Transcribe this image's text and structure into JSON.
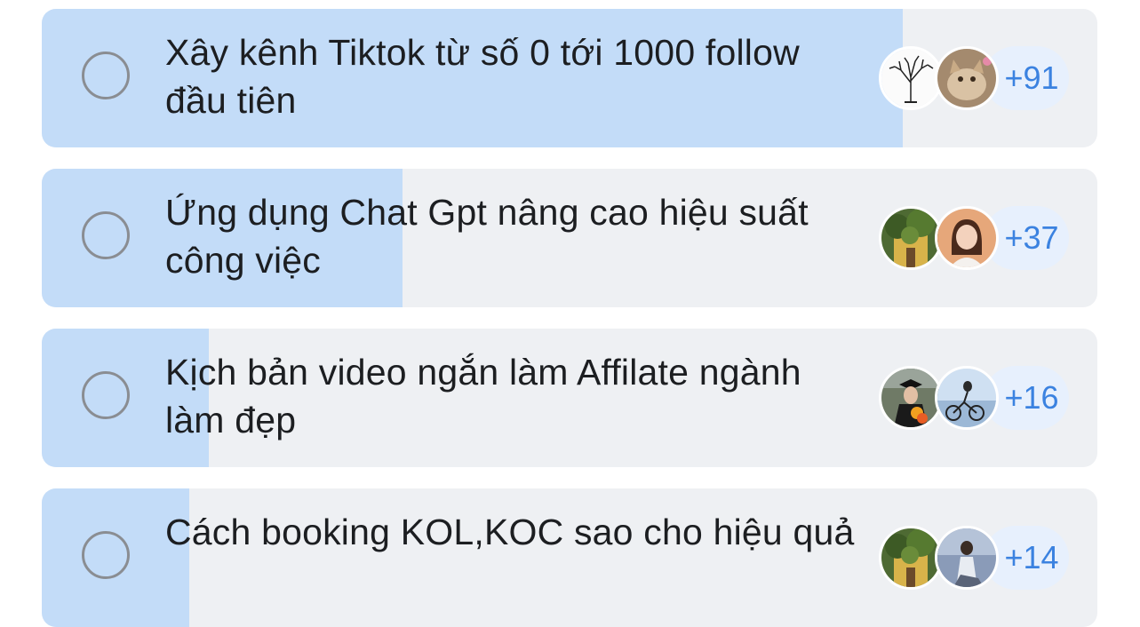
{
  "poll": {
    "accent_color": "#c3dcf8",
    "options": [
      {
        "label": "Xây kênh Tiktok từ số 0 tới 1000 follow đầu tiên",
        "vote_share": 0.816,
        "more_voters": "+91",
        "avatars": [
          "tree-sketch-avatar-icon",
          "kitten-photo-avatar-icon"
        ]
      },
      {
        "label": "Ứng dụng Chat Gpt nâng cao hiệu suất công việc",
        "vote_share": 0.342,
        "more_voters": "+37",
        "avatars": [
          "greenery-building-avatar-icon",
          "woman-portrait-avatar-icon"
        ]
      },
      {
        "label": "Kịch bản video ngắn làm Affilate ngành làm đẹp",
        "vote_share": 0.158,
        "more_voters": "+16",
        "avatars": [
          "graduate-flowers-avatar-icon",
          "bicycle-lake-avatar-icon"
        ]
      },
      {
        "label": "Cách booking KOL,KOC sao cho hiệu quả",
        "vote_share": 0.14,
        "more_voters": "+14",
        "avatars": [
          "greenery-building-avatar-icon",
          "woman-sitting-avatar-icon"
        ]
      }
    ]
  }
}
